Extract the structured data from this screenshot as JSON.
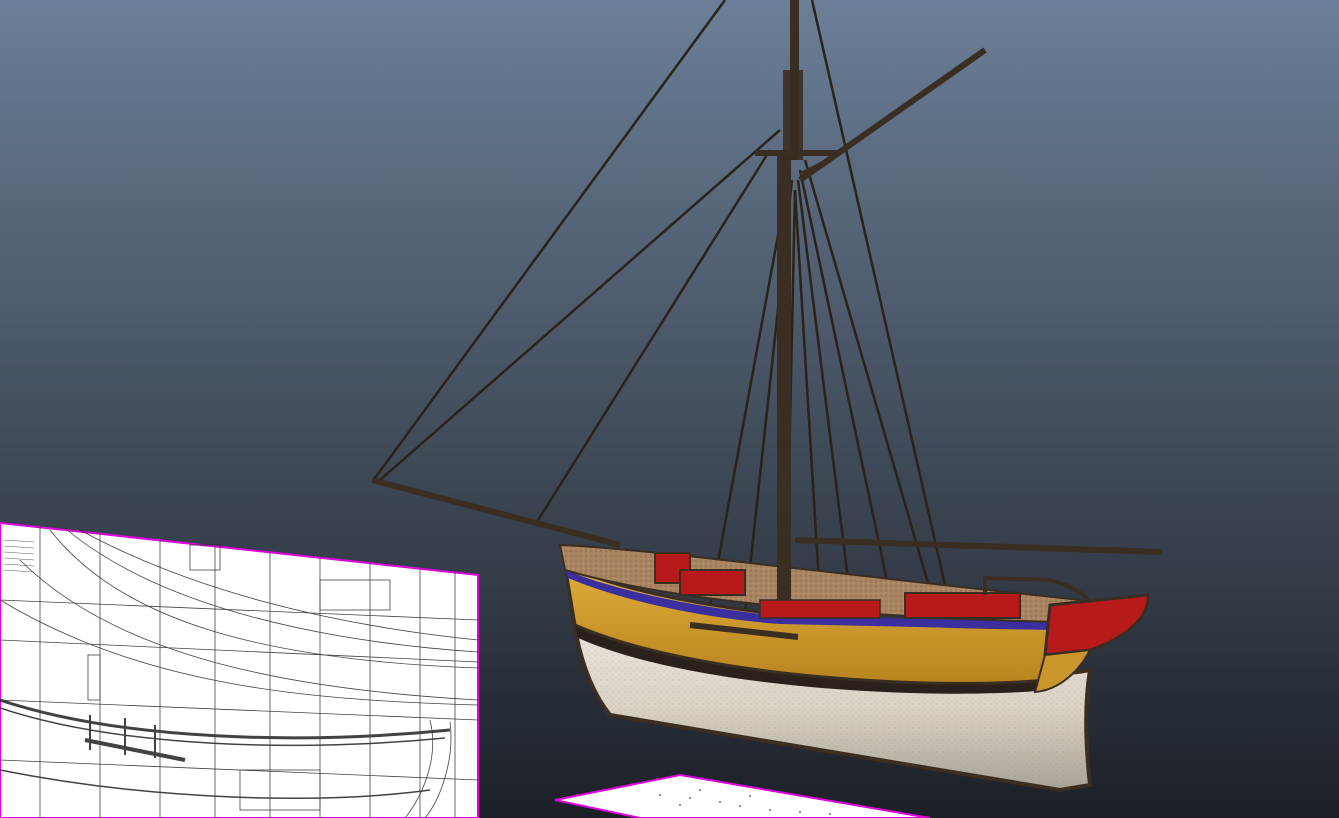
{
  "viewport": {
    "background_top": "#6b7f98",
    "background_bottom": "#1c2026",
    "selection_outline_color": "#e000e0"
  },
  "model": {
    "hull_upper_color": "#c9962b",
    "hull_lower_color": "#e4ded2",
    "hull_stripe_color": "#2a221a",
    "accent_blue": "#3b2fa0",
    "accent_red": "#b8191b",
    "deck_color": "#9a7a5a",
    "spar_color": "#3a2e22",
    "rigging_color": "#2b2218"
  },
  "reference_planes": [
    {
      "name": "side-profile-blueprint",
      "selected": true
    },
    {
      "name": "deck-plan-blueprint",
      "selected": true
    }
  ]
}
